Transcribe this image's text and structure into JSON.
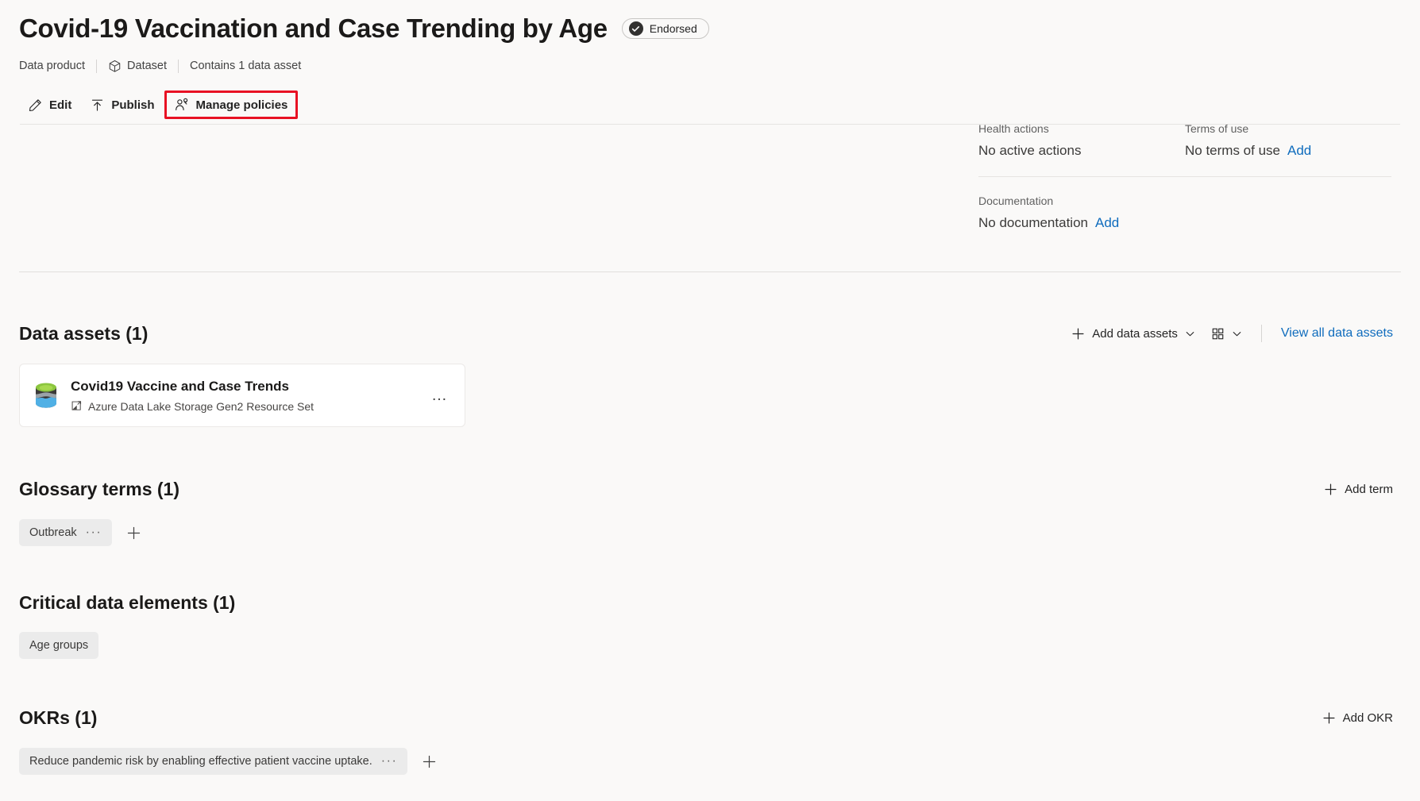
{
  "header": {
    "title": "Covid-19 Vaccination and Case Trending by Age",
    "endorsed_label": "Endorsed",
    "breadcrumb": [
      {
        "label": "Data product",
        "icon": ""
      },
      {
        "label": "Dataset",
        "icon": "cube-icon"
      },
      {
        "label": "Contains 1 data asset",
        "icon": ""
      }
    ]
  },
  "commandbar": {
    "edit_label": "Edit",
    "publish_label": "Publish",
    "manage_policies_label": "Manage policies",
    "highlight_color": "#e81123"
  },
  "info": {
    "health_actions_label": "Health actions",
    "health_actions_value": "No active actions",
    "terms_of_use_label": "Terms of use",
    "terms_of_use_value": "No terms of use",
    "terms_of_use_add": "Add",
    "documentation_label": "Documentation",
    "documentation_value": "No documentation",
    "documentation_add": "Add",
    "link_color": "#0f6cbd"
  },
  "data_assets": {
    "title": "Data assets (1)",
    "add_label": "Add data assets",
    "view_all_label": "View all data assets",
    "items": [
      {
        "name": "Covid19 Vaccine and Case Trends",
        "type": "Azure Data Lake Storage Gen2 Resource Set",
        "menu": "…"
      }
    ]
  },
  "glossary_terms": {
    "title": "Glossary terms (1)",
    "add_label": "Add term",
    "chips": [
      {
        "label": "Outbreak",
        "dots": "···"
      }
    ]
  },
  "critical_data_elements": {
    "title": "Critical data elements (1)",
    "chips": [
      {
        "label": "Age groups"
      }
    ]
  },
  "okrs": {
    "title": "OKRs (1)",
    "add_label": "Add OKR",
    "chips": [
      {
        "label": "Reduce pandemic risk by enabling effective patient vaccine uptake.",
        "dots": "···"
      }
    ]
  }
}
